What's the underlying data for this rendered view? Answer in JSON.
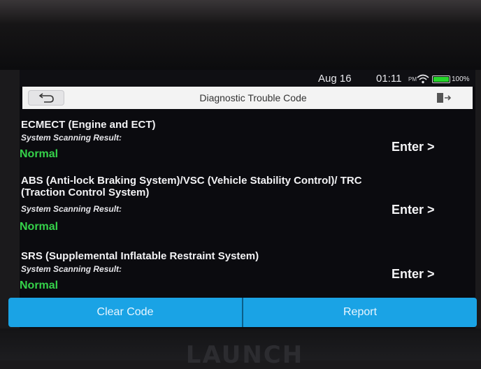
{
  "status_bar": {
    "date": "Aug 16",
    "time": "01:11",
    "ampm": "PM",
    "battery": "100%",
    "battery_color": "#27d62c"
  },
  "header": {
    "title": "Diagnostic Trouble Code",
    "back_icon": "back-arrow-icon",
    "exit_icon": "exit-icon"
  },
  "systems": [
    {
      "name": "ECMECT (Engine and ECT)",
      "scan_label": "System Scanning Result:",
      "status": "Normal",
      "action": "Enter >"
    },
    {
      "name": "ABS (Anti-lock Braking System)/VSC (Vehicle Stability Control)/ TRC (Traction Control System)",
      "scan_label": "System Scanning Result:",
      "status": "Normal",
      "action": "Enter >"
    },
    {
      "name": "SRS (Supplemental Inflatable Restraint System)",
      "scan_label": "System Scanning Result:",
      "status": "Normal",
      "action": "Enter >"
    }
  ],
  "footer": {
    "clear_label": "Clear Code",
    "report_label": "Report",
    "accent": "#1aa3e5"
  },
  "device": {
    "brand": "LAUNCH"
  },
  "colors": {
    "status_normal": "#35d24a"
  }
}
